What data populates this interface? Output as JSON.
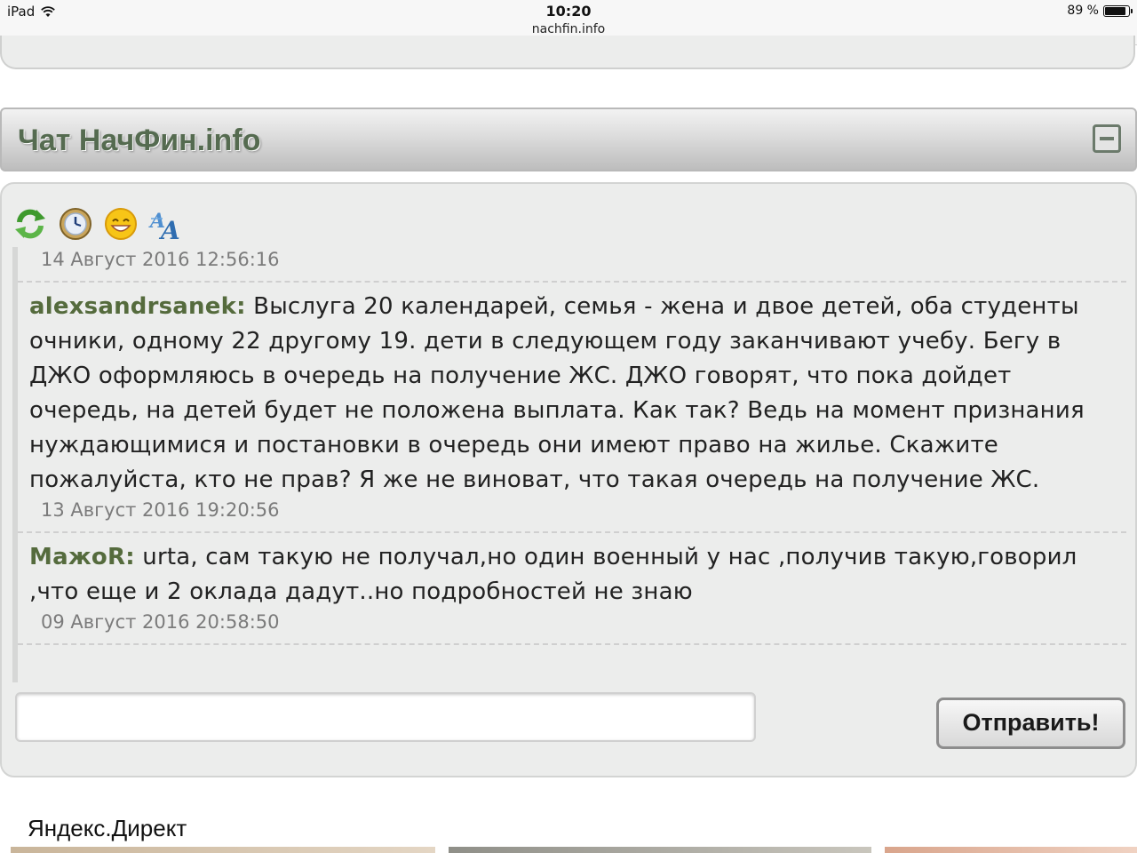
{
  "status_bar": {
    "device": "iPad",
    "time": "10:20",
    "url": "nachfin.info",
    "battery": "89 %",
    "battery_level": 0.89
  },
  "chat": {
    "title": "Чат НачФин.info",
    "toolbar_icons": [
      "refresh-icon",
      "clock-icon",
      "smiley-icon",
      "font-icon"
    ],
    "messages": [
      {
        "time": "14 Август 2016 12:56:16",
        "user": "alexsandrsanek",
        "text": "Выслуга 20 календарей, семья - жена и двое детей, оба студенты очники, одному 22 другому 19. дети в следующем году заканчивают учебу. Бегу в ДЖО оформляюсь в очередь на получение ЖС. ДЖО говорят, что пока дойдет очередь, на детей будет не положена выплата. Как так? Ведь на момент признания нуждающимися и постановки в очередь они имеют право на жилье. Скажите пожалуйста, кто не прав? Я же не виноват, что такая очередь на получение ЖС."
      },
      {
        "time": "13 Август 2016 19:20:56",
        "user": "МажоR",
        "text": "urta, сам такую не получал,но один военный у нас ,получив такую,говорил ,что еще и 2 оклада дадут..но подробностей не знаю"
      },
      {
        "time": "09 Август 2016 20:58:50"
      }
    ],
    "input_value": "",
    "send_label": "Отправить!"
  },
  "ads": {
    "label": "Яндекс.Директ"
  }
}
